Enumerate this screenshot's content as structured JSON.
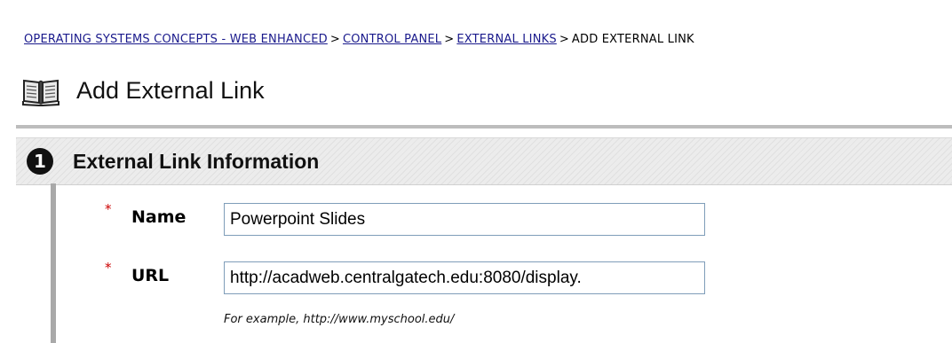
{
  "breadcrumb": {
    "items": [
      {
        "label": "OPERATING SYSTEMS CONCEPTS - WEB ENHANCED"
      },
      {
        "label": "CONTROL PANEL"
      },
      {
        "label": "EXTERNAL LINKS"
      }
    ],
    "separator": ">",
    "current": "ADD EXTERNAL LINK"
  },
  "page": {
    "title": "Add External Link",
    "icon": "book-icon"
  },
  "section": {
    "step_number": "1",
    "title": "External Link Information"
  },
  "form": {
    "required_marker": "*",
    "name": {
      "label": "Name",
      "value": "Powerpoint Slides"
    },
    "url": {
      "label": "URL",
      "value": "http://acadweb.centralgatech.edu:8080/display.",
      "example": "For example, http://www.myschool.edu/"
    }
  },
  "colors": {
    "link": "#1a1a8c",
    "required": "#cc0000",
    "section_bg": "#ececec",
    "input_border": "#7f9db9"
  }
}
